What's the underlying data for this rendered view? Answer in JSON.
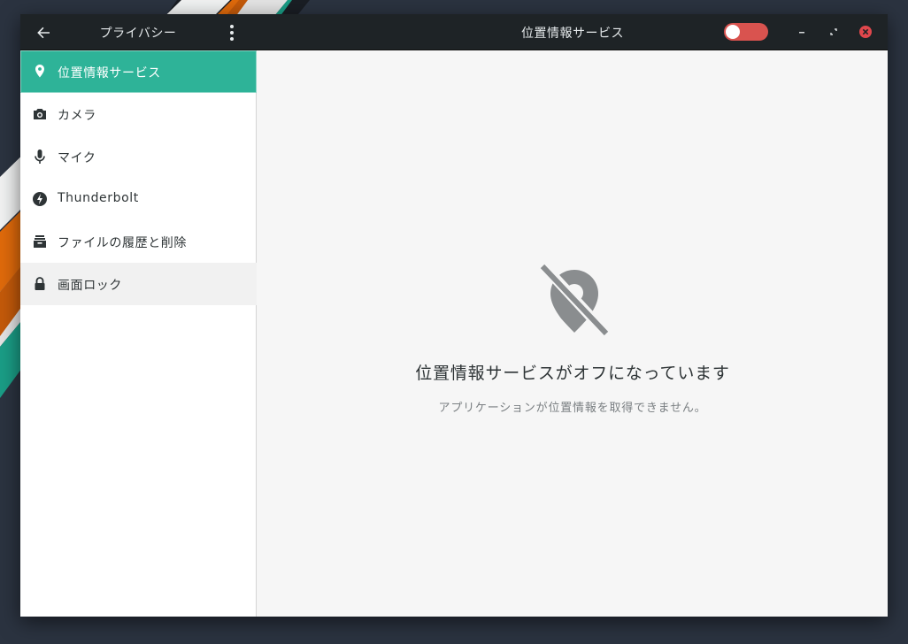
{
  "header": {
    "back_icon": "arrow-left-icon",
    "left_title": "プライバシー",
    "menu_icon": "vertical-dots-icon",
    "center_title": "位置情報サービス",
    "toggle_state": "off",
    "toggle_color": "#d9534f",
    "window_controls": [
      "minimize",
      "maximize",
      "close"
    ],
    "close_color": "#e0474c"
  },
  "sidebar": {
    "accent": "#2eb398",
    "items": [
      {
        "label": "位置情報サービス",
        "icon": "location-pin-icon",
        "active": true
      },
      {
        "label": "カメラ",
        "icon": "camera-icon"
      },
      {
        "label": "マイク",
        "icon": "microphone-icon"
      },
      {
        "label": "Thunderbolt",
        "icon": "thunderbolt-icon"
      },
      {
        "label": "ファイルの履歴と削除",
        "icon": "file-archive-icon"
      },
      {
        "label": "画面ロック",
        "icon": "lock-icon",
        "hover": true
      }
    ]
  },
  "main": {
    "icon": "location-disabled-icon",
    "title": "位置情報サービスがオフになっています",
    "subtitle": "アプリケーションが位置情報を取得できません。"
  }
}
